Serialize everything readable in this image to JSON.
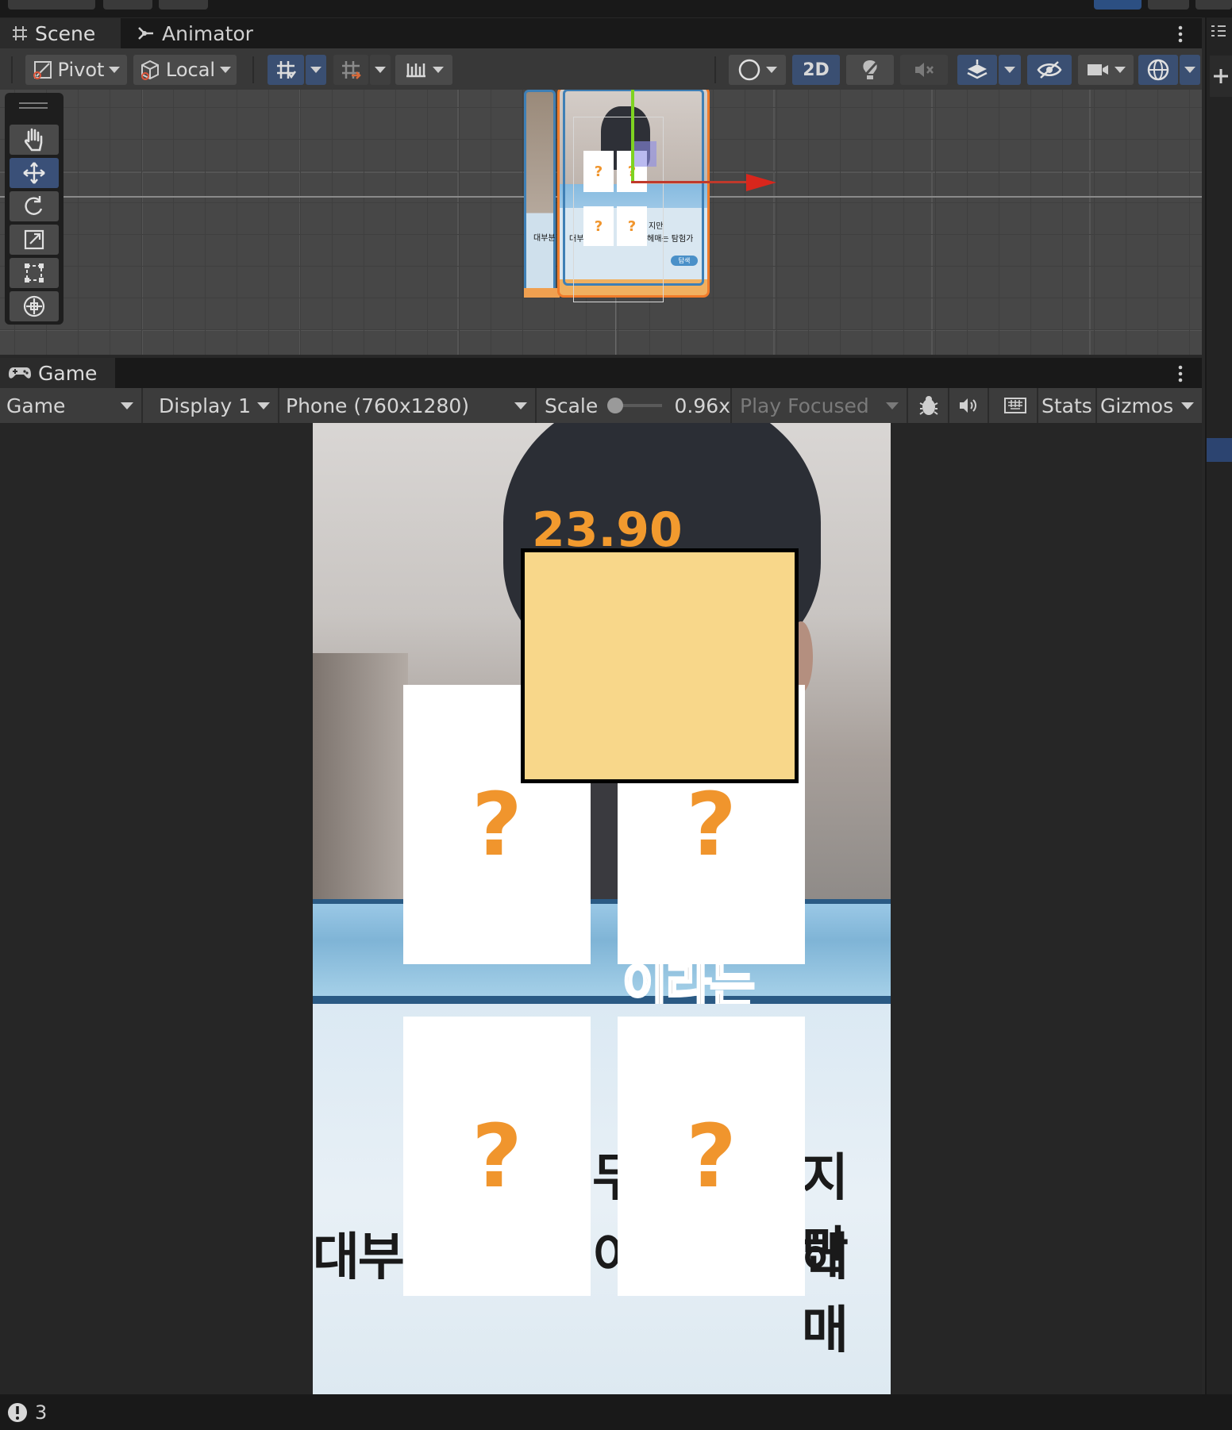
{
  "scene_tabs": {
    "scene": "Scene",
    "animator": "Animator"
  },
  "scene_toolbar": {
    "pivot": "Pivot",
    "local": "Local",
    "two_d": "2D"
  },
  "game_tab": {
    "label": "Game"
  },
  "game_toolbar": {
    "mode": "Game",
    "display": "Display 1",
    "resolution": "Phone (760x1280)",
    "scale_label": "Scale",
    "scale_value": "0.96x",
    "play_mode": "Play Focused",
    "stats": "Stats",
    "gizmos": "Gizmos"
  },
  "game": {
    "timer": "23.90",
    "card_symbol": "?",
    "banner_fragment": "이라는",
    "left_text_1": "대부",
    "mid_text_1": "무",
    "mid_text_2": "이",
    "right_text_1": "지만",
    "right_text_2": "헤매"
  },
  "scene_preview": {
    "left_text": "대부분",
    "mid_text": "대부",
    "right_text_1": "지만",
    "right_text_2": "헤매는 탐험가",
    "badge": "탐색"
  },
  "status": {
    "warning_count": "3"
  },
  "colors": {
    "accent": "#f29a2e",
    "panel": "#f8d78a",
    "selected": "#3a5078"
  }
}
